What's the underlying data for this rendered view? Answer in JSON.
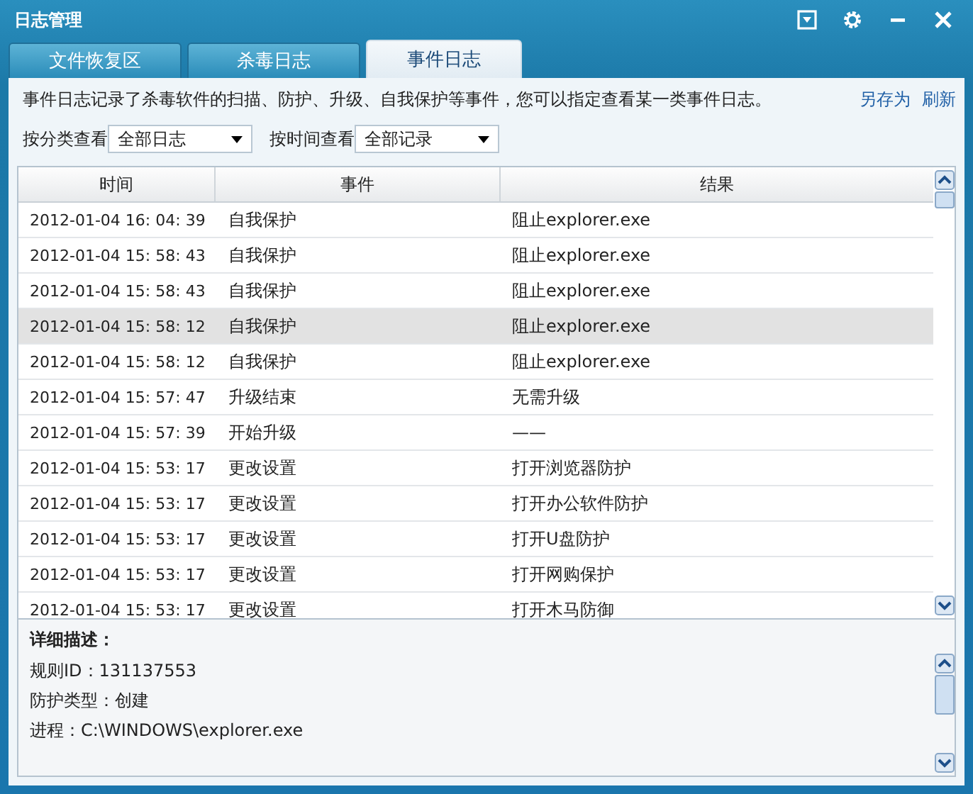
{
  "window": {
    "title": "日志管理"
  },
  "tabs": [
    {
      "label": "文件恢复区",
      "selected": false
    },
    {
      "label": "杀毒日志",
      "selected": false
    },
    {
      "label": "事件日志",
      "selected": true
    }
  ],
  "description": "事件日志记录了杀毒软件的扫描、防护、升级、自我保护等事件，您可以指定查看某一类事件日志。",
  "links": [
    "另存为",
    "刷新"
  ],
  "filters": [
    {
      "label": "按分类查看",
      "value": "全部日志"
    },
    {
      "label": "按时间查看",
      "value": "全部记录"
    }
  ],
  "table": {
    "columns": [
      "时间",
      "事件",
      "结果"
    ],
    "rows": [
      {
        "time": "2012-01-04 16: 04: 39",
        "event": "自我保护",
        "result": "阻止explorer.exe",
        "selected": false
      },
      {
        "time": "2012-01-04 15: 58: 43",
        "event": "自我保护",
        "result": "阻止explorer.exe",
        "selected": false
      },
      {
        "time": "2012-01-04 15: 58: 43",
        "event": "自我保护",
        "result": "阻止explorer.exe",
        "selected": false
      },
      {
        "time": "2012-01-04 15: 58: 12",
        "event": "自我保护",
        "result": "阻止explorer.exe",
        "selected": true
      },
      {
        "time": "2012-01-04 15: 58: 12",
        "event": "自我保护",
        "result": "阻止explorer.exe",
        "selected": false
      },
      {
        "time": "2012-01-04 15: 57: 47",
        "event": "升级结束",
        "result": "无需升级",
        "selected": false
      },
      {
        "time": "2012-01-04 15: 57: 39",
        "event": "开始升级",
        "result": "——",
        "selected": false
      },
      {
        "time": "2012-01-04 15: 53: 17",
        "event": "更改设置",
        "result": "打开浏览器防护",
        "selected": false
      },
      {
        "time": "2012-01-04 15: 53: 17",
        "event": "更改设置",
        "result": "打开办公软件防护",
        "selected": false
      },
      {
        "time": "2012-01-04 15: 53: 17",
        "event": "更改设置",
        "result": "打开U盘防护",
        "selected": false
      },
      {
        "time": "2012-01-04 15: 53: 17",
        "event": "更改设置",
        "result": "打开网购保护",
        "selected": false
      },
      {
        "time": "2012-01-04 15: 53: 17",
        "event": "更改设置",
        "result": "打开木马防御",
        "selected": false
      }
    ]
  },
  "details": {
    "title": "详细描述：",
    "lines": [
      "规则ID：131137553",
      "防护类型：创建",
      "进程：C:\\WINDOWS\\explorer.exe"
    ]
  }
}
